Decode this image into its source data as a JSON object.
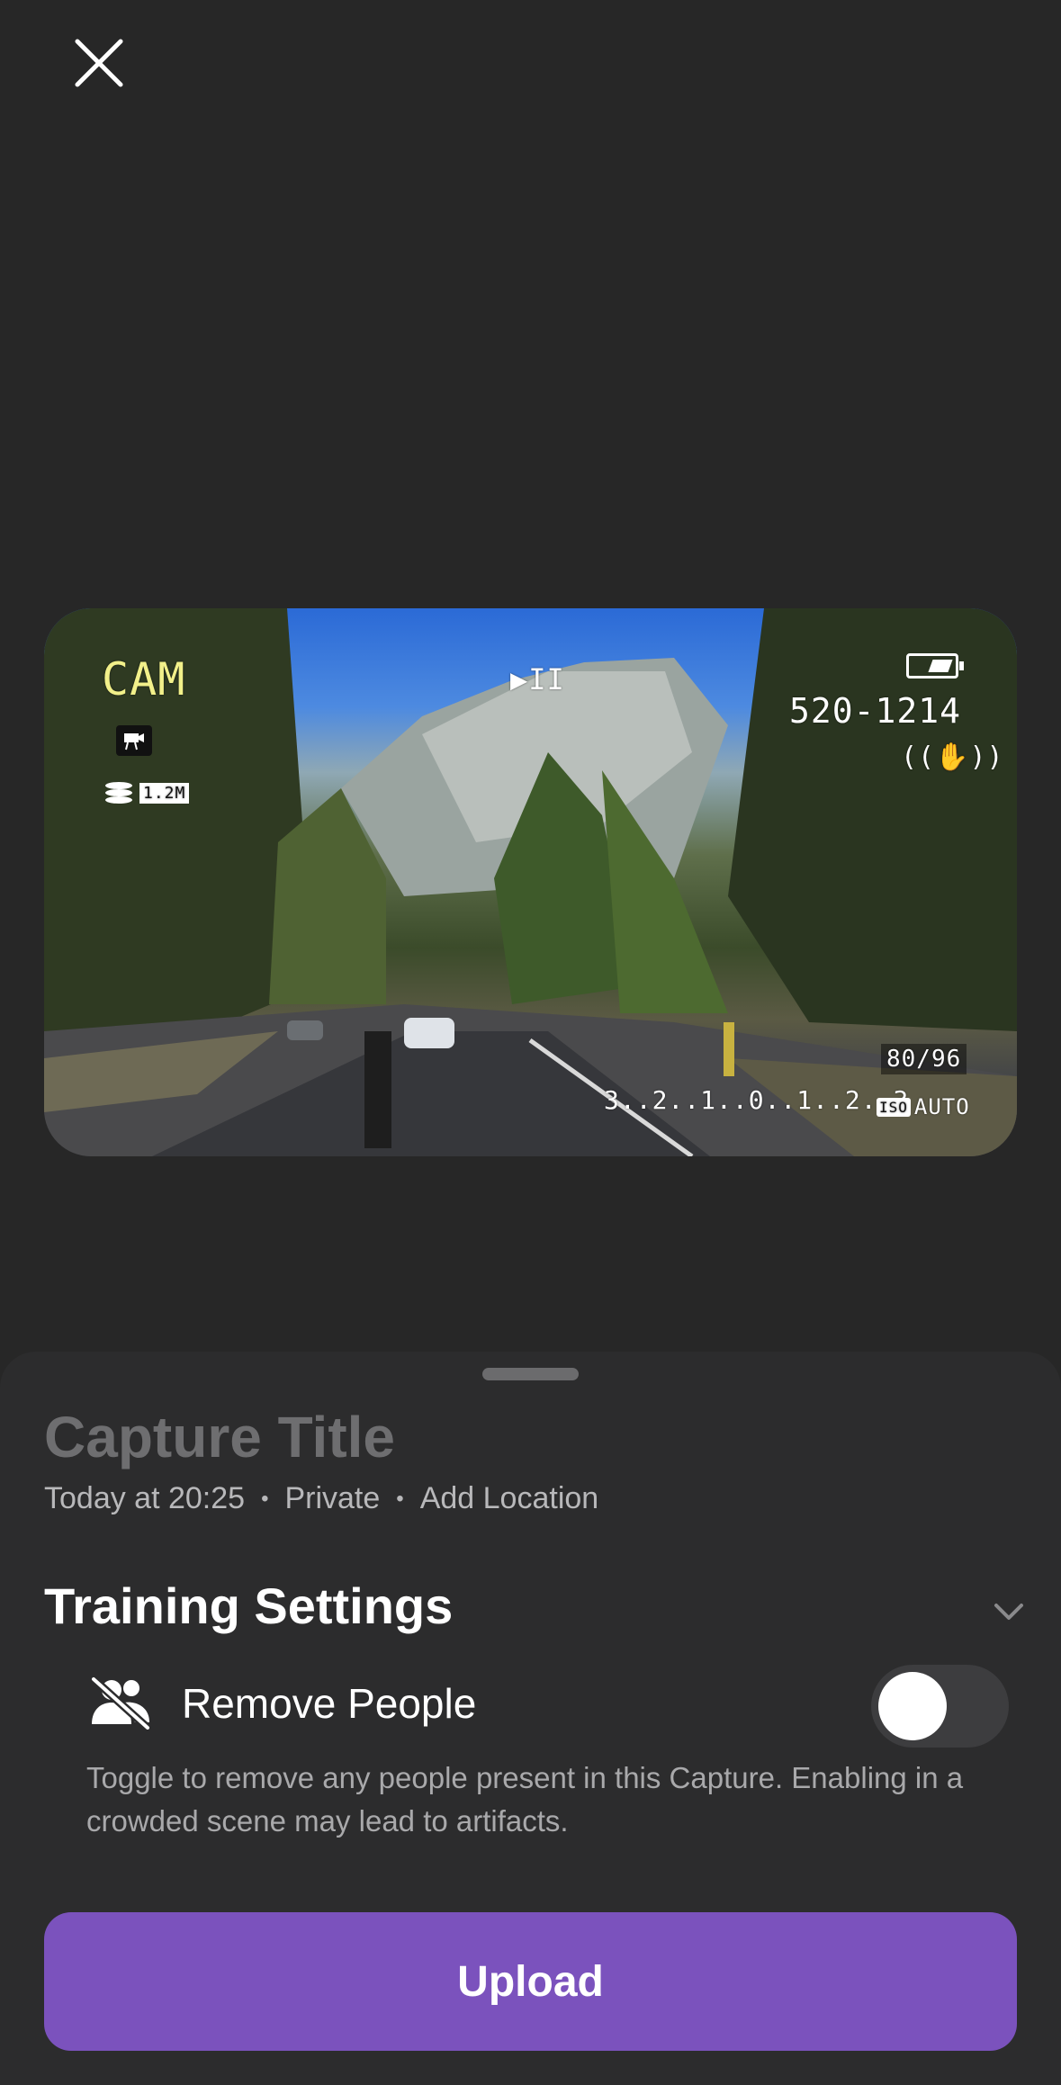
{
  "header": {
    "close_icon": "close-icon"
  },
  "preview": {
    "osd": {
      "mode": "CAM",
      "play_pause": "▶II",
      "counter": "520-1214",
      "stabilize": "((✋))",
      "storage_badge": "1.2M",
      "frame_count": "80/96",
      "exposure_scale": "3..2..1..0..1..2..3",
      "iso_badge": "ISO",
      "iso_value": "AUTO"
    }
  },
  "sheet": {
    "title_placeholder": "Capture Title",
    "meta": {
      "time": "Today at 20:25",
      "privacy": "Private",
      "location": "Add Location",
      "separator": "•"
    },
    "training_settings": {
      "title": "Training Settings",
      "remove_people": {
        "label": "Remove People",
        "enabled": false,
        "help": "Toggle to remove any people present in this Capture. Enabling in a crowded scene may lead to artifacts."
      }
    },
    "upload_label": "Upload"
  },
  "colors": {
    "background": "#272727",
    "sheet": "#2c2c2d",
    "accent": "#7b52bd"
  }
}
